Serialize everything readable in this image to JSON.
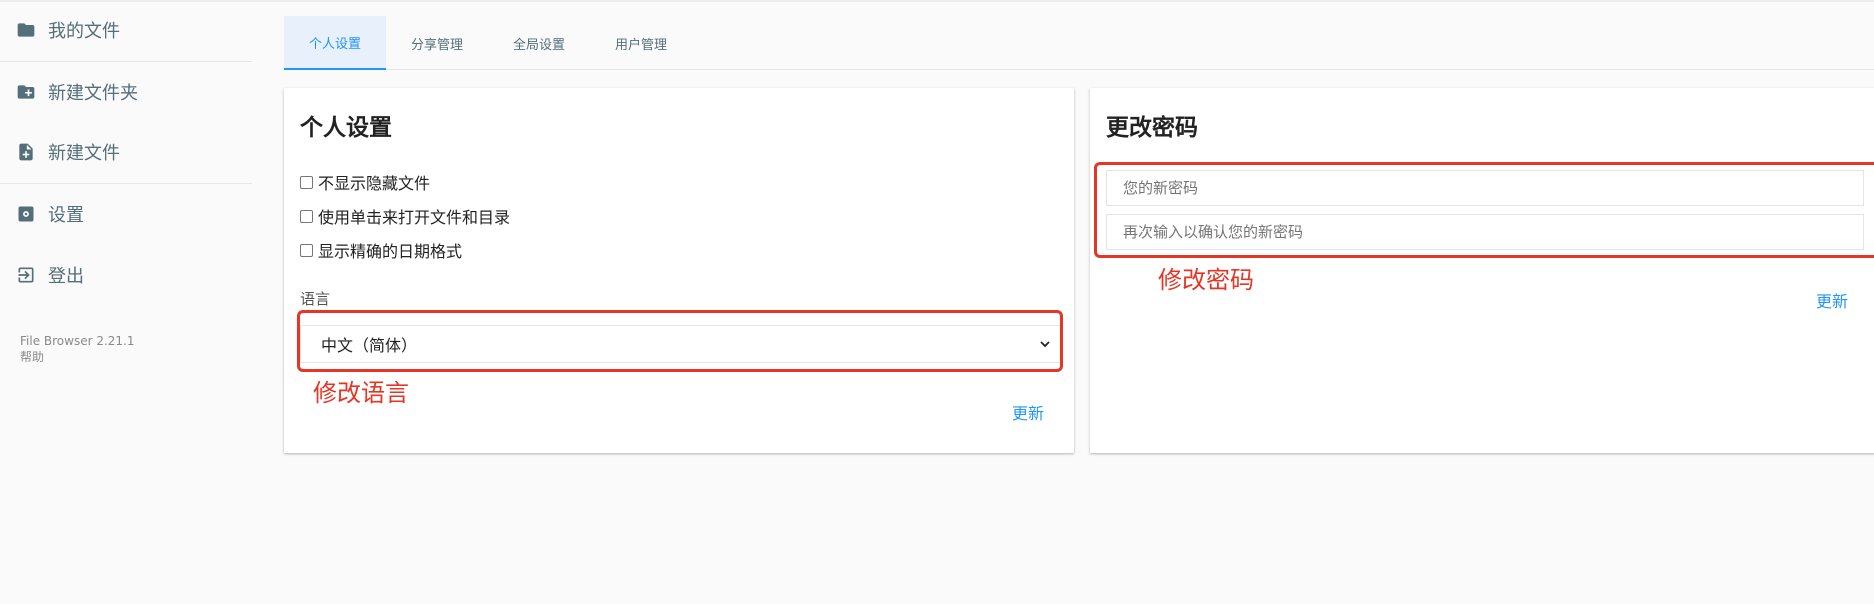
{
  "sidebar": {
    "items": [
      {
        "label": "我的文件",
        "icon": "folder-icon"
      },
      {
        "label": "新建文件夹",
        "icon": "folder-plus-icon"
      },
      {
        "label": "新建文件",
        "icon": "file-plus-icon"
      },
      {
        "label": "设置",
        "icon": "settings-icon"
      },
      {
        "label": "登出",
        "icon": "logout-icon"
      }
    ],
    "version": "File Browser 2.21.1",
    "help": "帮助"
  },
  "tabs": [
    "个人设置",
    "分享管理",
    "全局设置",
    "用户管理"
  ],
  "profile": {
    "title": "个人设置",
    "checkboxes": [
      "不显示隐藏文件",
      "使用单击来打开文件和目录",
      "显示精确的日期格式"
    ],
    "language_label": "语言",
    "language_value": "中文（简体）",
    "update_label": "更新",
    "annotation": "修改语言"
  },
  "password": {
    "title": "更改密码",
    "new_placeholder": "您的新密码",
    "confirm_placeholder": "再次输入以确认您的新密码",
    "update_label": "更新",
    "annotation": "修改密码"
  },
  "colors": {
    "accent": "#2196f3",
    "annotation": "#e53525",
    "sidebar_text": "#546e7a"
  }
}
